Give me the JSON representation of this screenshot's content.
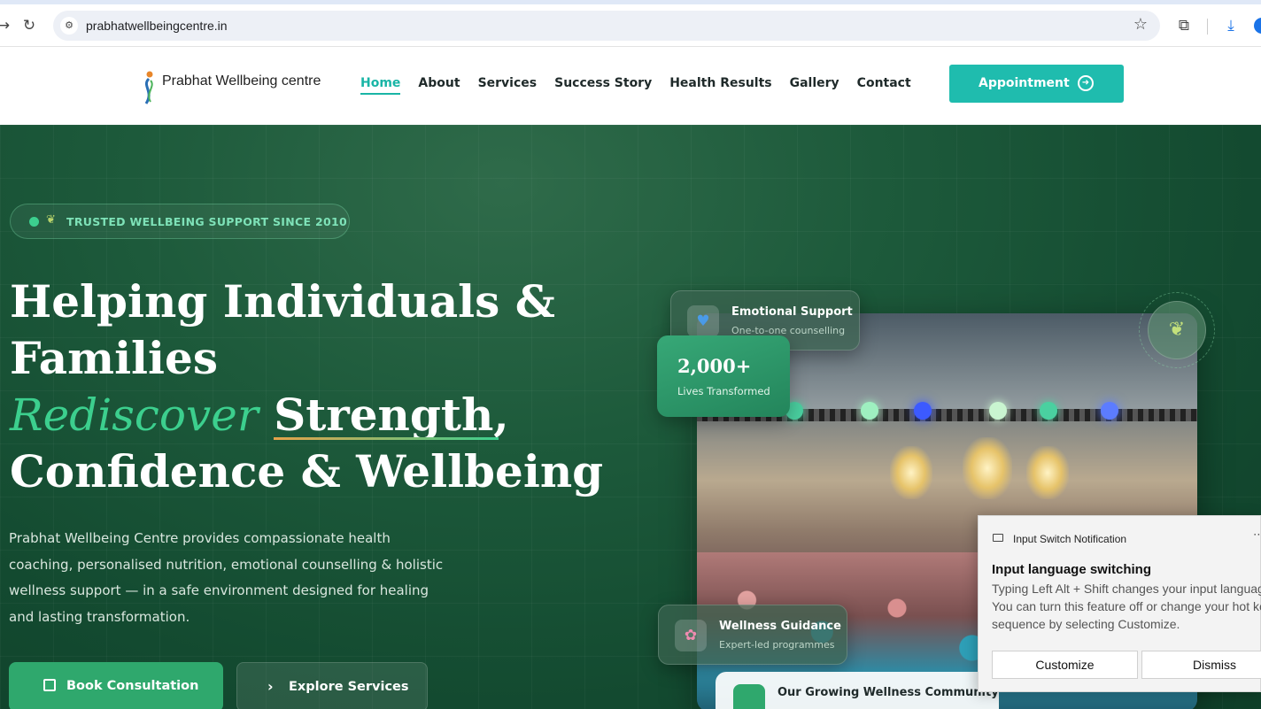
{
  "browser": {
    "url": "prabhatwellbeingcentre.in"
  },
  "header": {
    "logo_text": "Prabhat Wellbeing centre",
    "nav": [
      {
        "label": "Home",
        "active": true
      },
      {
        "label": "About"
      },
      {
        "label": "Services"
      },
      {
        "label": "Success Story"
      },
      {
        "label": "Health Results"
      },
      {
        "label": "Gallery"
      },
      {
        "label": "Contact"
      }
    ],
    "appointment_label": "Appointment"
  },
  "hero": {
    "badge": "TRUSTED WELLBEING SUPPORT SINCE 2010",
    "headline_line1": "Helping Individuals &",
    "headline_line2": "Families",
    "headline_italic": "Rediscover",
    "headline_line3_rest": "Strength,",
    "headline_line4": "Confidence & Wellbeing",
    "description": "Prabhat Wellbeing Centre provides compassionate health coaching, personalised nutrition, emotional counselling & holistic wellness support — in a safe environment designed for healing and lasting transformation.",
    "primary_button": "Book Consultation",
    "secondary_button": "Explore Services",
    "accent_color": "#3ccf8e"
  },
  "cards": {
    "emotional_title": "Emotional Support",
    "emotional_sub": "One-to-one counselling",
    "stat_number": "2,000+",
    "stat_label": "Lives Transformed",
    "guidance_title": "Wellness Guidance",
    "guidance_sub": "Expert-led programmes",
    "community_title": "Our Growing Wellness Community"
  },
  "notification": {
    "app": "Input Switch Notification",
    "title": "Input language switching",
    "body": "Typing Left Alt + Shift changes your input language. You can turn this feature off or change your hot key sequence by selecting Customize.",
    "customize": "Customize",
    "dismiss": "Dismiss"
  }
}
